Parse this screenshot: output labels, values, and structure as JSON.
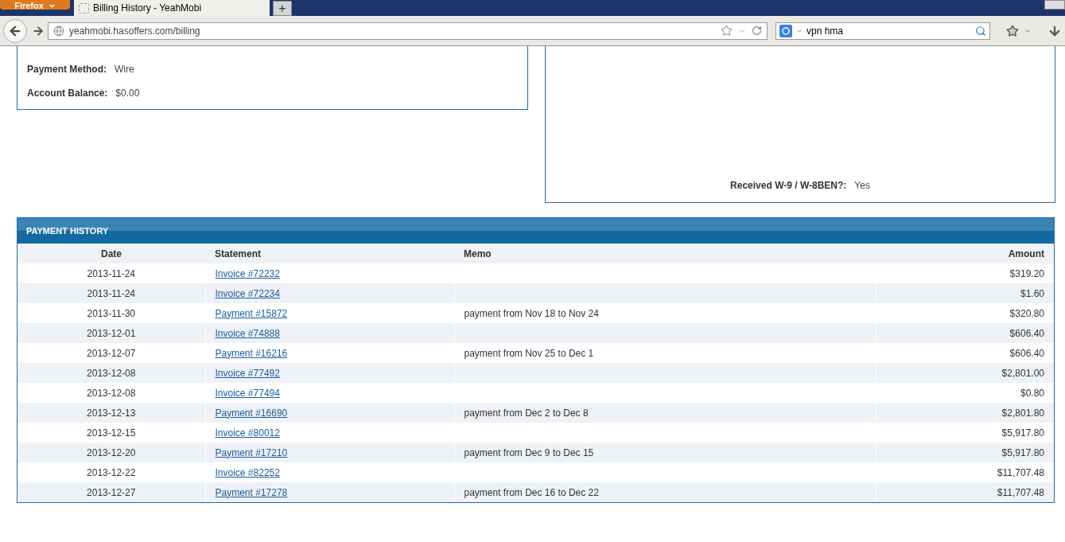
{
  "browser": {
    "menu_button": "Firefox",
    "tabs": [
      {
        "title": "Billing History - YeahMobi",
        "selected": true
      }
    ],
    "new_tab": "+",
    "url": "yeahmobi.hasoffers.com/billing",
    "search": {
      "value": "vpn hma"
    }
  },
  "account_card": {
    "fields": [
      {
        "label": "Payment Method:",
        "value": "Wire"
      },
      {
        "label": "Account Balance:",
        "value": "$0.00"
      }
    ]
  },
  "tax_card": {
    "fields": [
      {
        "label": "Received W-9 / W-8BEN?:",
        "value": "Yes"
      }
    ]
  },
  "payment_history": {
    "title": "PAYMENT HISTORY",
    "columns": [
      "Date",
      "Statement",
      "Memo",
      "Amount"
    ],
    "rows": [
      {
        "date": "2013-11-24",
        "statement": "Invoice #72232",
        "memo": "",
        "amount": "$319.20"
      },
      {
        "date": "2013-11-24",
        "statement": "Invoice #72234",
        "memo": "",
        "amount": "$1.60"
      },
      {
        "date": "2013-11-30",
        "statement": "Payment #15872",
        "memo": "payment from Nov 18 to Nov 24",
        "amount": "$320.80"
      },
      {
        "date": "2013-12-01",
        "statement": "Invoice #74888",
        "memo": "",
        "amount": "$606.40"
      },
      {
        "date": "2013-12-07",
        "statement": "Payment #16216",
        "memo": "payment from Nov 25 to Dec 1",
        "amount": "$606.40"
      },
      {
        "date": "2013-12-08",
        "statement": "Invoice #77492",
        "memo": "",
        "amount": "$2,801.00"
      },
      {
        "date": "2013-12-08",
        "statement": "Invoice #77494",
        "memo": "",
        "amount": "$0.80"
      },
      {
        "date": "2013-12-13",
        "statement": "Payment #16690",
        "memo": "payment from Dec 2 to Dec 8",
        "amount": "$2,801.80"
      },
      {
        "date": "2013-12-15",
        "statement": "Invoice #80012",
        "memo": "",
        "amount": "$5,917.80"
      },
      {
        "date": "2013-12-20",
        "statement": "Payment #17210",
        "memo": "payment from Dec 9 to Dec 15",
        "amount": "$5,917.80"
      },
      {
        "date": "2013-12-22",
        "statement": "Invoice #82252",
        "memo": "",
        "amount": "$11,707.48"
      },
      {
        "date": "2013-12-27",
        "statement": "Payment #17278",
        "memo": "payment from Dec 16 to Dec 22",
        "amount": "$11,707.48"
      }
    ]
  }
}
